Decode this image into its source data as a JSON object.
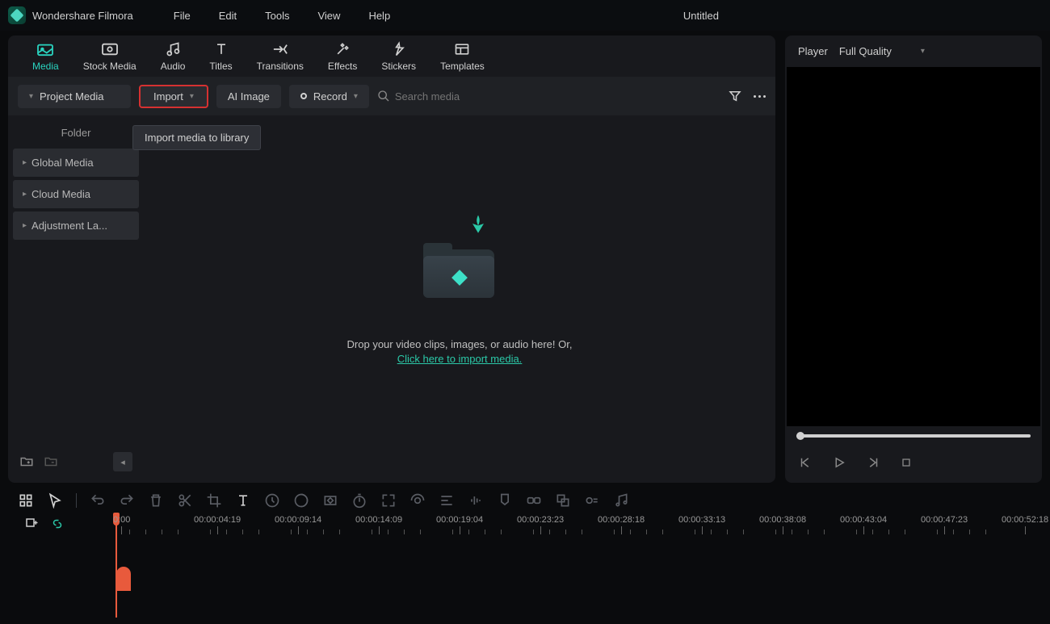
{
  "app": {
    "name": "Wondershare Filmora"
  },
  "menus": {
    "file": "File",
    "edit": "Edit",
    "tools": "Tools",
    "view": "View",
    "help": "Help"
  },
  "project_title": "Untitled",
  "tabs": {
    "media": "Media",
    "stock_media": "Stock Media",
    "audio": "Audio",
    "titles": "Titles",
    "transitions": "Transitions",
    "effects": "Effects",
    "stickers": "Stickers",
    "templates": "Templates"
  },
  "toolbar": {
    "project_media": "Project Media",
    "import": "Import",
    "ai_image": "AI Image",
    "record": "Record",
    "search_placeholder": "Search media"
  },
  "tooltip": {
    "import": "Import media to library"
  },
  "sidebar": {
    "folder": "Folder",
    "global_media": "Global Media",
    "cloud_media": "Cloud Media",
    "adjustment_layer": "Adjustment La..."
  },
  "drop": {
    "text": "Drop your video clips, images, or audio here! Or,",
    "link": "Click here to import media."
  },
  "player": {
    "label": "Player",
    "quality": "Full Quality"
  },
  "timeline": {
    "ticks": [
      "0:00",
      "00:00:04:19",
      "00:00:09:14",
      "00:00:14:09",
      "00:00:19:04",
      "00:00:23:23",
      "00:00:28:18",
      "00:00:33:13",
      "00:00:38:08",
      "00:00:43:04",
      "00:00:47:23",
      "00:00:52:18"
    ]
  }
}
